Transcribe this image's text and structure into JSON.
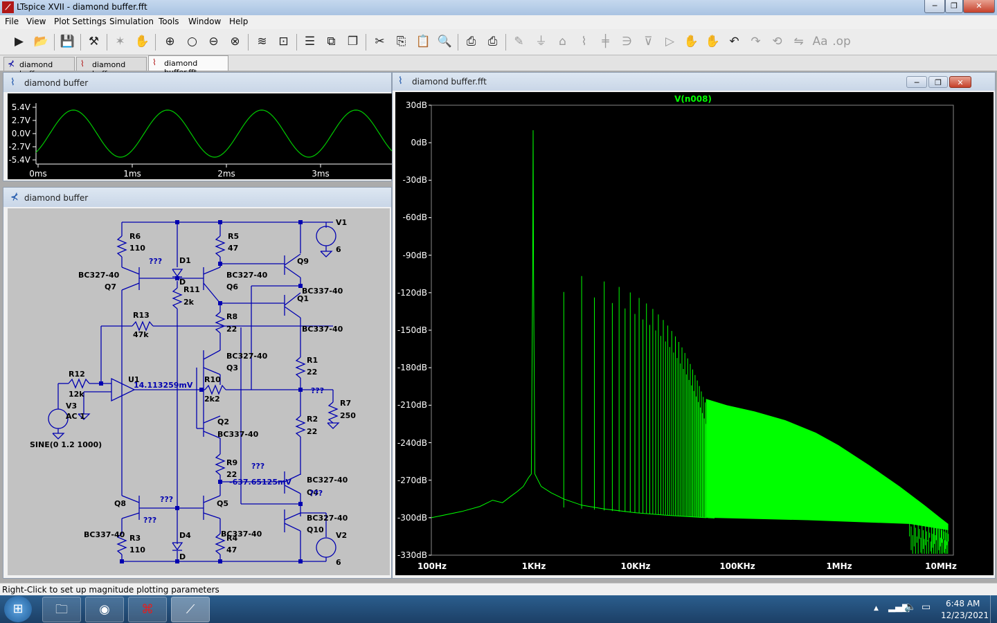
{
  "window": {
    "title": "LTspice XVII - diamond buffer.fft",
    "minimize": "─",
    "restore": "❐",
    "close": "✕"
  },
  "menu": [
    "File",
    "View",
    "Plot Settings",
    "Simulation",
    "Tools",
    "Window",
    "Help"
  ],
  "tabs": [
    {
      "label": "diamond buffer",
      "icon": "schematic-icon"
    },
    {
      "label": "diamond buffer",
      "icon": "waveform-icon"
    },
    {
      "label": "diamond buffer.fft",
      "icon": "waveform-icon"
    }
  ],
  "transient": {
    "title": "diamond buffer",
    "y_ticks": [
      "5.4V",
      "2.7V",
      "0.0V",
      "-2.7V",
      "-5.4V"
    ],
    "x_ticks": [
      "0ms",
      "1ms",
      "2ms",
      "3ms"
    ],
    "color": "#00cc00"
  },
  "schematic": {
    "title": "diamond buffer",
    "labels": {
      "r6": "R6",
      "r6v": "110",
      "r5": "R5",
      "r5v": "47",
      "v1": "V1",
      "v1n": "6",
      "q9": "Q9",
      "d1": "D1",
      "bc327a": "BC327-40",
      "q7": "Q7",
      "q6a": "BC327-40",
      "q6": "Q6",
      "r11": "R11",
      "r11v": "2k",
      "q1": "BC337-40",
      "q1n": "Q1",
      "q1b": "BC337-40",
      "r13": "R13",
      "r13v": "47k",
      "r8": "R8",
      "r8v": "22",
      "q3a": "BC327-40",
      "q3": "Q3",
      "r1": "R1",
      "r1v": "22",
      "r12": "R12",
      "r12v": "12k",
      "u1": "U1",
      "u1v": "14.113259mV",
      "r10": "R10",
      "r10v": "2k2",
      "q3q": "???",
      "r7": "R7",
      "r7v": "250",
      "v3": "V3",
      "ac": "AC 1",
      "q2": "Q2",
      "q2a": "BC337-40",
      "r2": "R2",
      "r2v": "22",
      "sine": "SINE(0 1.2 1000)",
      "r9": "R9",
      "r9v": "22",
      "q4q": "???",
      "q4v": "-637.65125mV",
      "q4a": "BC327-40",
      "q4": "Q4",
      "q8": "Q8",
      "q8q": "???",
      "q5": "Q5",
      "q5q": "???",
      "q10a": "BC327-40",
      "q10": "Q10",
      "q8a": "BC337-40",
      "r3": "R3",
      "r3v": "110",
      "d4": "D4",
      "r4a": "BC337-40",
      "r4": "R4",
      "r4v": "47",
      "v2": "V2",
      "v2n": "6",
      "dnode": "D",
      "q7q": "???",
      "q4q2": "???",
      "d4d": "D"
    }
  },
  "fft": {
    "title": "diamond buffer.fft",
    "trace": "V(n008)",
    "y_ticks": [
      "30dB",
      "0dB",
      "-30dB",
      "-60dB",
      "-90dB",
      "-120dB",
      "-150dB",
      "-180dB",
      "-210dB",
      "-240dB",
      "-270dB",
      "-300dB",
      "-330dB"
    ],
    "x_ticks": [
      "100Hz",
      "1KHz",
      "10KHz",
      "100KHz",
      "1MHz",
      "10MHz"
    ],
    "color": "#00ff00"
  },
  "status": "Right-Click to set up magnitude plotting parameters",
  "tray": {
    "time": "6:48 AM",
    "date": "12/23/2021",
    "show_hidden": "▲"
  }
}
